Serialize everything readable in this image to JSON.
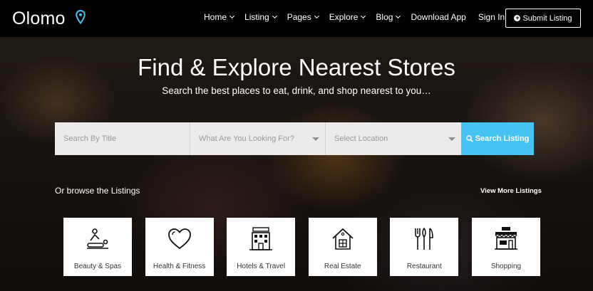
{
  "brand": {
    "name": "Olomo",
    "pin_color": "#46c3f3"
  },
  "nav": {
    "items": [
      {
        "label": "Home",
        "dropdown": true
      },
      {
        "label": "Listing",
        "dropdown": true
      },
      {
        "label": "Pages",
        "dropdown": true
      },
      {
        "label": "Explore",
        "dropdown": true
      },
      {
        "label": "Blog",
        "dropdown": true
      },
      {
        "label": "Download App",
        "dropdown": false
      },
      {
        "label": "Sign In",
        "dropdown": false
      }
    ],
    "submit_label": "Submit Listing"
  },
  "hero": {
    "title": "Find & Explore Nearest Stores",
    "subtitle": "Search the best places to eat, drink, and shop nearest to you…"
  },
  "search": {
    "title_placeholder": "Search By Title",
    "category_placeholder": "What Are You Looking For?",
    "location_placeholder": "Select Location",
    "button_label": "Search Listing",
    "button_color": "#46c3f3"
  },
  "browse": {
    "label": "Or browse the Listings",
    "view_more": "View More Listings",
    "categories": [
      {
        "label": "Beauty & Spas",
        "icon": "massage-icon"
      },
      {
        "label": "Health & Fitness",
        "icon": "heart-icon"
      },
      {
        "label": "Hotels & Travel",
        "icon": "hotel-icon"
      },
      {
        "label": "Real Estate",
        "icon": "house-icon"
      },
      {
        "label": "Restaurant",
        "icon": "cutlery-icon"
      },
      {
        "label": "Shopping",
        "icon": "shop-icon"
      }
    ]
  }
}
